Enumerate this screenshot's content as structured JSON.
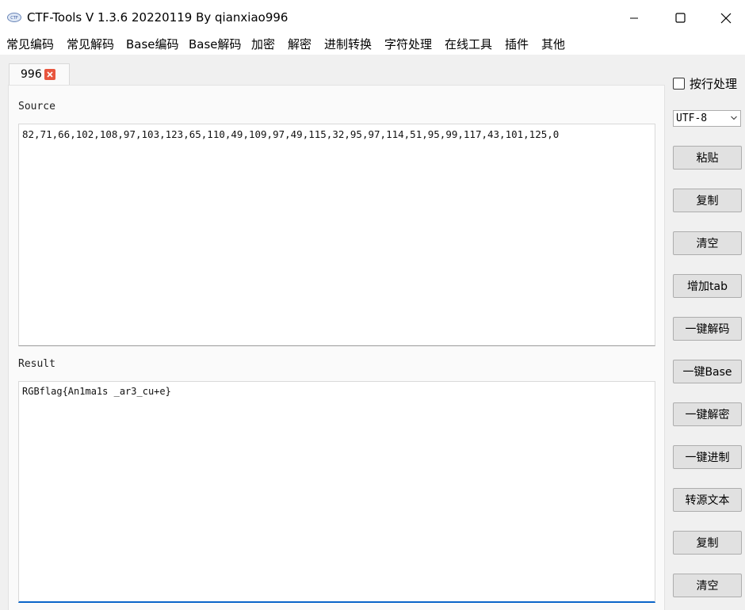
{
  "window": {
    "title": "CTF-Tools V 1.3.6 20220119 By qianxiao996"
  },
  "menu": [
    "常见编码",
    "常见解码",
    "Base编码",
    "Base解码",
    "加密",
    "解密",
    "进制转换",
    "字符处理",
    "在线工具",
    "插件",
    "其他"
  ],
  "tab": {
    "label": "996"
  },
  "source": {
    "label": "Source",
    "value": "82,71,66,102,108,97,103,123,65,110,49,109,97,49,115,32,95,97,114,51,95,99,117,43,101,125,0"
  },
  "result": {
    "label": "Result",
    "value": "RGBflag{An1ma1s _ar3_cu+e}"
  },
  "sidebar": {
    "checkbox_label": "按行处理",
    "encoding": "UTF-8",
    "buttons": [
      "粘贴",
      "复制",
      "清空",
      "增加tab",
      "一键解码",
      "一键Base",
      "一键解密",
      "一键进制",
      "转源文本",
      "复制",
      "清空"
    ]
  },
  "colors": {
    "accent": "#0a64c8",
    "tab_close": "#e8563f"
  }
}
